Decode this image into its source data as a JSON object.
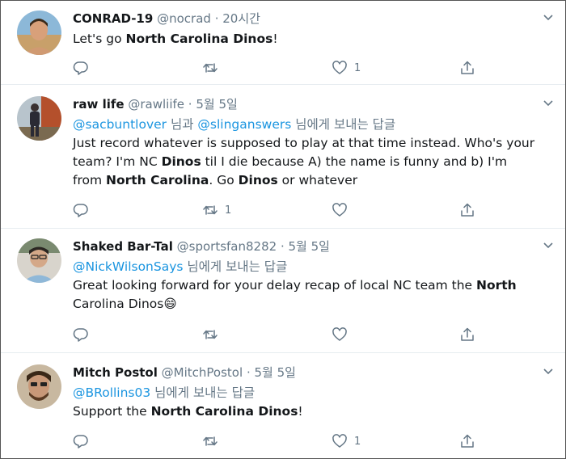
{
  "tweets": [
    {
      "name": "CONRAD-19",
      "handle": "@nocrad",
      "sep": "·",
      "time": "20시간",
      "text_pre": "Let's go ",
      "text_bold": "North Carolina Dinos",
      "text_post": "!",
      "retweets": "",
      "likes": "1"
    },
    {
      "name": "raw life",
      "handle": "@rawliife",
      "sep": "·",
      "time": "5월 5일",
      "mention1": "@sacbuntlover",
      "joiner": " 님과 ",
      "mention2": "@slinganswers",
      "reply_suffix": " 님에게 보내는 답글",
      "l1": "Just record whatever is supposed to play at that time instead. Who's your",
      "l2a": "team? I'm NC ",
      "l2b": "Dinos",
      "l2c": " til I die because A) the name is funny and b) I'm",
      "l3a": "from ",
      "l3b": "North Carolina",
      "l3c": ".  Go ",
      "l3d": "Dinos",
      "l3e": " or whatever",
      "retweets": "1",
      "likes": ""
    },
    {
      "name": "Shaked Bar-Tal",
      "handle": "@sportsfan8282",
      "sep": "·",
      "time": "5월 5일",
      "mention1": "@NickWilsonSays",
      "reply_suffix": " 님에게 보내는 답글",
      "l1a": "Great looking forward for your delay recap of local NC team the ",
      "l1b": "North",
      "l2a": "Carolina Dinos",
      "emoji": "😄",
      "retweets": "",
      "likes": ""
    },
    {
      "name": "Mitch Postol",
      "handle": "@MitchPostol",
      "sep": "·",
      "time": "5월 5일",
      "mention1": "@BRollins03",
      "reply_suffix": " 님에게 보내는 답글",
      "text_pre": "Support the ",
      "text_bold": "North Carolina Dinos",
      "text_post": "!",
      "retweets": "",
      "likes": "1"
    }
  ],
  "colors": {
    "mention": "#1b95e0",
    "meta": "#657786",
    "divider": "#e6ecf0"
  }
}
